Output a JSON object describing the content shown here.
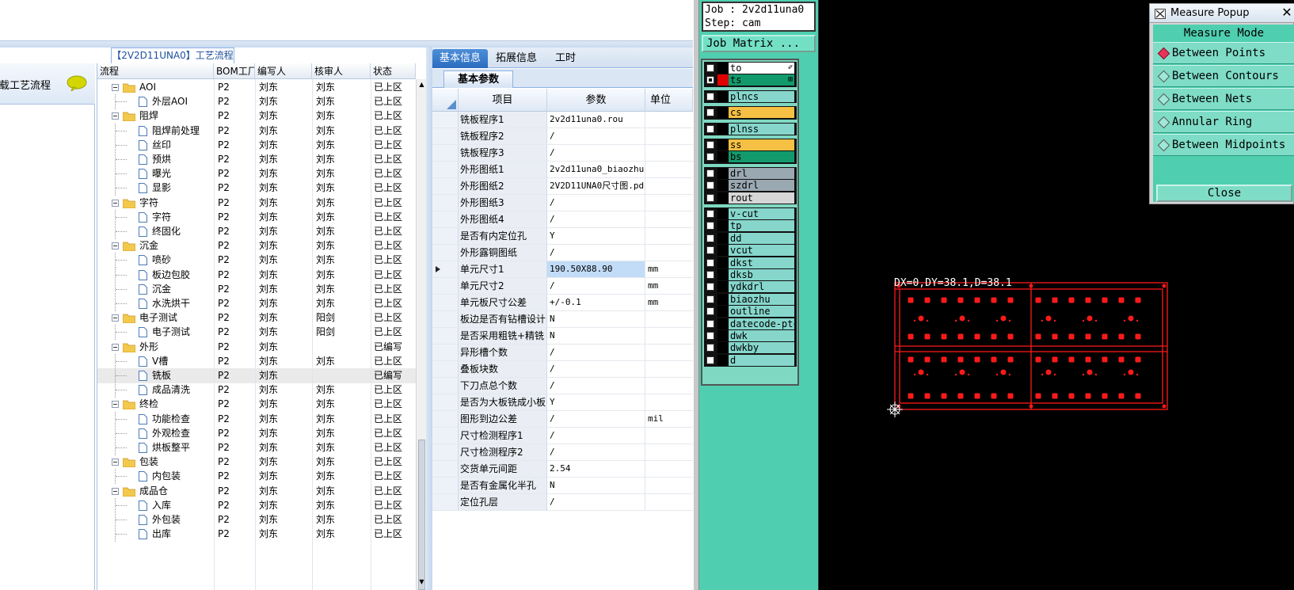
{
  "left_app": {
    "left_panel_label": "加载工艺流程",
    "flow_title": "【2V2D11UNA0】工艺流程"
  },
  "flow_grid": {
    "columns": [
      "流程",
      "BOM工厂",
      "编写人",
      "核审人",
      "状态"
    ],
    "rows": [
      {
        "level": 0,
        "type": "folder",
        "name": "AOI",
        "bom": "P2",
        "author": "刘东",
        "reviewer": "刘东",
        "status": "已上区"
      },
      {
        "level": 1,
        "type": "file",
        "name": "外层AOI",
        "bom": "P2",
        "author": "刘东",
        "reviewer": "刘东",
        "status": "已上区"
      },
      {
        "level": 0,
        "type": "folder",
        "name": "阻焊",
        "bom": "P2",
        "author": "刘东",
        "reviewer": "刘东",
        "status": "已上区"
      },
      {
        "level": 1,
        "type": "file",
        "name": "阻焊前处理",
        "bom": "P2",
        "author": "刘东",
        "reviewer": "刘东",
        "status": "已上区"
      },
      {
        "level": 1,
        "type": "file",
        "name": "丝印",
        "bom": "P2",
        "author": "刘东",
        "reviewer": "刘东",
        "status": "已上区"
      },
      {
        "level": 1,
        "type": "file",
        "name": "预烘",
        "bom": "P2",
        "author": "刘东",
        "reviewer": "刘东",
        "status": "已上区"
      },
      {
        "level": 1,
        "type": "file",
        "name": "曝光",
        "bom": "P2",
        "author": "刘东",
        "reviewer": "刘东",
        "status": "已上区"
      },
      {
        "level": 1,
        "type": "file",
        "name": "显影",
        "bom": "P2",
        "author": "刘东",
        "reviewer": "刘东",
        "status": "已上区"
      },
      {
        "level": 0,
        "type": "folder",
        "name": "字符",
        "bom": "P2",
        "author": "刘东",
        "reviewer": "刘东",
        "status": "已上区"
      },
      {
        "level": 1,
        "type": "file",
        "name": "字符",
        "bom": "P2",
        "author": "刘东",
        "reviewer": "刘东",
        "status": "已上区"
      },
      {
        "level": 1,
        "type": "file",
        "name": "终固化",
        "bom": "P2",
        "author": "刘东",
        "reviewer": "刘东",
        "status": "已上区"
      },
      {
        "level": 0,
        "type": "folder",
        "name": "沉金",
        "bom": "P2",
        "author": "刘东",
        "reviewer": "刘东",
        "status": "已上区"
      },
      {
        "level": 1,
        "type": "file",
        "name": "喷砂",
        "bom": "P2",
        "author": "刘东",
        "reviewer": "刘东",
        "status": "已上区"
      },
      {
        "level": 1,
        "type": "file",
        "name": "板边包胶",
        "bom": "P2",
        "author": "刘东",
        "reviewer": "刘东",
        "status": "已上区"
      },
      {
        "level": 1,
        "type": "file",
        "name": "沉金",
        "bom": "P2",
        "author": "刘东",
        "reviewer": "刘东",
        "status": "已上区"
      },
      {
        "level": 1,
        "type": "file",
        "name": "水洗烘干",
        "bom": "P2",
        "author": "刘东",
        "reviewer": "刘东",
        "status": "已上区"
      },
      {
        "level": 0,
        "type": "folder",
        "name": "电子测试",
        "bom": "P2",
        "author": "刘东",
        "reviewer": "阳剑",
        "status": "已上区"
      },
      {
        "level": 1,
        "type": "file",
        "name": "电子测试",
        "bom": "P2",
        "author": "刘东",
        "reviewer": "阳剑",
        "status": "已上区"
      },
      {
        "level": 0,
        "type": "folder",
        "name": "外形",
        "bom": "P2",
        "author": "刘东",
        "reviewer": "",
        "status": "已编写"
      },
      {
        "level": 1,
        "type": "file",
        "name": "V槽",
        "bom": "P2",
        "author": "刘东",
        "reviewer": "刘东",
        "status": "已上区"
      },
      {
        "level": 1,
        "type": "file",
        "name": "铣板",
        "bom": "P2",
        "author": "刘东",
        "reviewer": "",
        "status": "已编写",
        "selected": true
      },
      {
        "level": 1,
        "type": "file",
        "name": "成品清洗",
        "bom": "P2",
        "author": "刘东",
        "reviewer": "刘东",
        "status": "已上区"
      },
      {
        "level": 0,
        "type": "folder",
        "name": "终检",
        "bom": "P2",
        "author": "刘东",
        "reviewer": "刘东",
        "status": "已上区"
      },
      {
        "level": 1,
        "type": "file",
        "name": "功能检查",
        "bom": "P2",
        "author": "刘东",
        "reviewer": "刘东",
        "status": "已上区"
      },
      {
        "level": 1,
        "type": "file",
        "name": "外观检查",
        "bom": "P2",
        "author": "刘东",
        "reviewer": "刘东",
        "status": "已上区"
      },
      {
        "level": 1,
        "type": "file",
        "name": "烘板整平",
        "bom": "P2",
        "author": "刘东",
        "reviewer": "刘东",
        "status": "已上区"
      },
      {
        "level": 0,
        "type": "folder",
        "name": "包装",
        "bom": "P2",
        "author": "刘东",
        "reviewer": "刘东",
        "status": "已上区"
      },
      {
        "level": 1,
        "type": "file",
        "name": "内包装",
        "bom": "P2",
        "author": "刘东",
        "reviewer": "刘东",
        "status": "已上区"
      },
      {
        "level": 0,
        "type": "folder",
        "name": "成品仓",
        "bom": "P2",
        "author": "刘东",
        "reviewer": "刘东",
        "status": "已上区"
      },
      {
        "level": 1,
        "type": "file",
        "name": "入库",
        "bom": "P2",
        "author": "刘东",
        "reviewer": "刘东",
        "status": "已上区"
      },
      {
        "level": 1,
        "type": "file",
        "name": "外包装",
        "bom": "P2",
        "author": "刘东",
        "reviewer": "刘东",
        "status": "已上区"
      },
      {
        "level": 1,
        "type": "file",
        "name": "出库",
        "bom": "P2",
        "author": "刘东",
        "reviewer": "刘东",
        "status": "已上区"
      }
    ]
  },
  "tabs": [
    {
      "label": "基本信息",
      "active": true
    },
    {
      "label": "拓展信息",
      "active": false
    },
    {
      "label": "工时",
      "active": false
    }
  ],
  "subtab": "基本参数",
  "param_table": {
    "columns": [
      "项目",
      "参数",
      "单位"
    ],
    "rows": [
      {
        "item": "铣板程序1",
        "value": "2v2d11una0.rou",
        "unit": ""
      },
      {
        "item": "铣板程序2",
        "value": "/",
        "unit": ""
      },
      {
        "item": "铣板程序3",
        "value": "/",
        "unit": ""
      },
      {
        "item": "外形图纸1",
        "value": "2v2d11una0_biaozhu...",
        "unit": ""
      },
      {
        "item": "外形图纸2",
        "value": "2V2D11UNA0尺寸图.pdf",
        "unit": ""
      },
      {
        "item": "外形图纸3",
        "value": "/",
        "unit": ""
      },
      {
        "item": "外形图纸4",
        "value": "/",
        "unit": ""
      },
      {
        "item": "是否有内定位孔",
        "value": "Y",
        "unit": ""
      },
      {
        "item": "外形露铜图纸",
        "value": "/",
        "unit": ""
      },
      {
        "item": "单元尺寸1",
        "value": "190.50X88.90",
        "unit": "mm",
        "current": true
      },
      {
        "item": "单元尺寸2",
        "value": "/",
        "unit": "mm"
      },
      {
        "item": "单元板尺寸公差",
        "value": "+/-0.1",
        "unit": "mm"
      },
      {
        "item": "板边是否有钻槽设计",
        "value": "N",
        "unit": ""
      },
      {
        "item": "是否采用粗铣+精铣",
        "value": "N",
        "unit": ""
      },
      {
        "item": "异形槽个数",
        "value": "/",
        "unit": ""
      },
      {
        "item": "叠板块数",
        "value": "/",
        "unit": ""
      },
      {
        "item": "下刀点总个数",
        "value": "/",
        "unit": ""
      },
      {
        "item": "是否为大板铣成小板",
        "value": "Y",
        "unit": ""
      },
      {
        "item": "图形到边公差",
        "value": "/",
        "unit": "mil"
      },
      {
        "item": "尺寸检测程序1",
        "value": "/",
        "unit": ""
      },
      {
        "item": "尺寸检测程序2",
        "value": "/",
        "unit": ""
      },
      {
        "item": "交货单元间距",
        "value": "2.54",
        "unit": ""
      },
      {
        "item": "是否有金属化半孔",
        "value": "N",
        "unit": ""
      },
      {
        "item": "定位孔层",
        "value": "/",
        "unit": ""
      }
    ]
  },
  "cam": {
    "job_line": "Job : 2v2d11una0",
    "step_line": "Step: cam",
    "job_matrix_label": "Job Matrix ...",
    "layer_groups": [
      [
        {
          "name": "to",
          "color": "#ffffff",
          "checked": false,
          "mark": "",
          "suffix": "✐"
        },
        {
          "name": "ts",
          "color": "#129a6c",
          "checked": true,
          "mark": "#e00000",
          "suffix": "⊞"
        }
      ],
      [
        {
          "name": "plncs",
          "color": "#86d6cc",
          "checked": false,
          "mark": ""
        }
      ],
      [
        {
          "name": "cs",
          "color": "#f5c043",
          "checked": false,
          "mark": ""
        }
      ],
      [
        {
          "name": "plnss",
          "color": "#86d6cc",
          "checked": false,
          "mark": ""
        }
      ],
      [
        {
          "name": "ss",
          "color": "#f5c043",
          "checked": false,
          "mark": ""
        },
        {
          "name": "bs",
          "color": "#129a6c",
          "checked": false,
          "mark": ""
        }
      ],
      [
        {
          "name": "drl",
          "color": "#9aa8b2",
          "checked": false,
          "mark": ""
        },
        {
          "name": "szdrl",
          "color": "#9aa8b2",
          "checked": false,
          "mark": ""
        },
        {
          "name": "rout",
          "color": "#d6d6d6",
          "checked": false,
          "mark": ""
        }
      ],
      [
        {
          "name": "v-cut",
          "color": "#86d6cc",
          "checked": false,
          "mark": ""
        },
        {
          "name": "tp",
          "color": "#86d6cc",
          "checked": false,
          "mark": ""
        },
        {
          "name": "dd",
          "color": "#86d6cc",
          "checked": false,
          "mark": ""
        },
        {
          "name": "vcut",
          "color": "#86d6cc",
          "checked": false,
          "mark": ""
        },
        {
          "name": "dkst",
          "color": "#86d6cc",
          "checked": false,
          "mark": ""
        },
        {
          "name": "dksb",
          "color": "#86d6cc",
          "checked": false,
          "mark": ""
        },
        {
          "name": "ydkdrl",
          "color": "#86d6cc",
          "checked": false,
          "mark": ""
        },
        {
          "name": "biaozhu",
          "color": "#86d6cc",
          "checked": false,
          "mark": ""
        },
        {
          "name": "outline",
          "color": "#86d6cc",
          "checked": false,
          "mark": ""
        },
        {
          "name": "datecode-ptc",
          "color": "#86d6cc",
          "checked": false,
          "mark": ""
        },
        {
          "name": "dwk",
          "color": "#86d6cc",
          "checked": false,
          "mark": ""
        },
        {
          "name": "dwkby",
          "color": "#86d6cc",
          "checked": false,
          "mark": ""
        },
        {
          "name": "d",
          "color": "#86d6cc",
          "checked": false,
          "mark": ""
        }
      ]
    ],
    "measure_readout": "DX=0,DY=38.1,D=38.1"
  },
  "measure_popup": {
    "title": "Measure Popup",
    "close_x": "✕",
    "mode_title": "Measure Mode",
    "options": [
      {
        "label": "Between Points",
        "selected": true
      },
      {
        "label": "Between Contours",
        "selected": false
      },
      {
        "label": "Between Nets",
        "selected": false
      },
      {
        "label": "Annular Ring",
        "selected": false
      },
      {
        "label": "Between Midpoints",
        "selected": false
      }
    ],
    "close_label": "Close"
  },
  "colors": {
    "cam_panel": "#4fcfb0",
    "pcb_red": "#ff1a1a",
    "accent_blue": "#2b6cc0"
  }
}
